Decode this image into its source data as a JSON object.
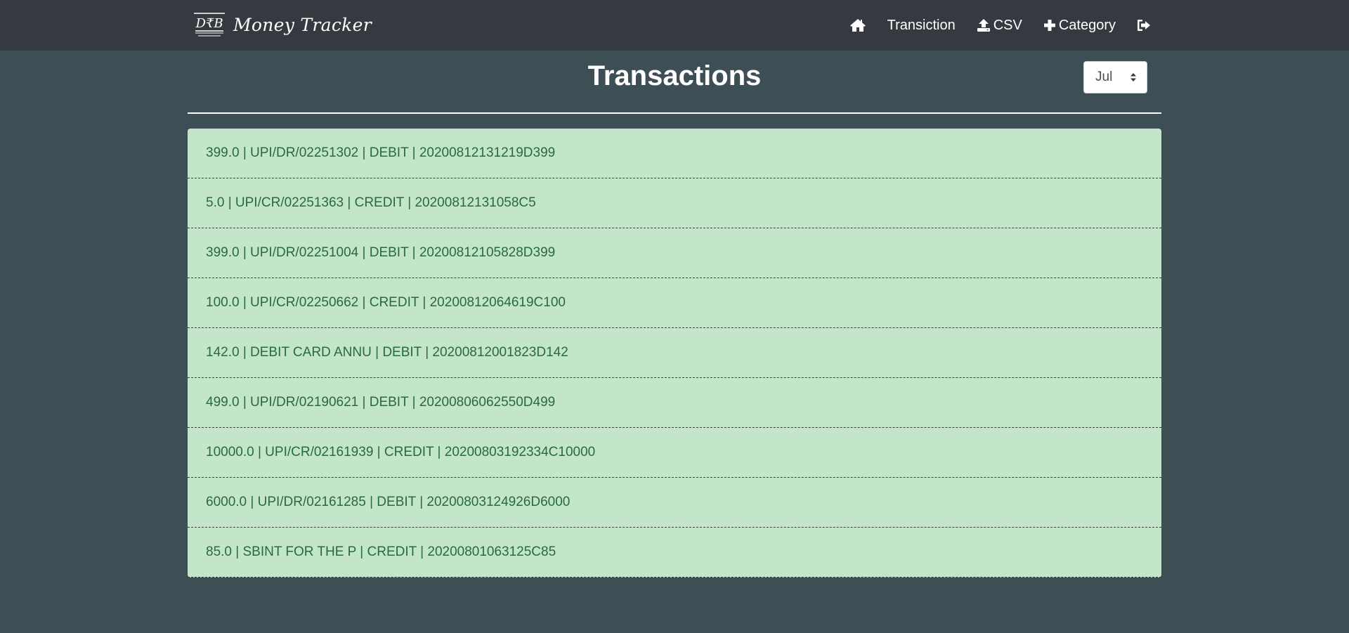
{
  "brand": {
    "name": "Money Tracker",
    "logo_text": "D₹B"
  },
  "nav": {
    "items": [
      {
        "icon": "home-icon",
        "label": ""
      },
      {
        "icon": "",
        "label": "Transiction"
      },
      {
        "icon": "upload-icon",
        "label": "CSV"
      },
      {
        "icon": "plus-icon",
        "label": "Category"
      },
      {
        "icon": "sign-out-icon",
        "label": ""
      }
    ]
  },
  "page": {
    "title": "Transactions"
  },
  "month_select": {
    "value": "Jul"
  },
  "transactions": [
    "399.0 | UPI/DR/02251302 | DEBIT | 20200812131219D399",
    "5.0 | UPI/CR/02251363 | CREDIT | 20200812131058C5",
    "399.0 | UPI/DR/02251004 | DEBIT | 20200812105828D399",
    "100.0 | UPI/CR/02250662 | CREDIT | 20200812064619C100",
    "142.0 | DEBIT CARD ANNU | DEBIT | 20200812001823D142",
    "499.0 | UPI/DR/02190621 | DEBIT | 20200806062550D499",
    "10000.0 | UPI/CR/02161939 | CREDIT | 20200803192334C10000",
    "6000.0 | UPI/DR/02161285 | DEBIT | 20200803124926D6000",
    "85.0 | SBINT FOR THE P | CREDIT | 20200801063125C85"
  ],
  "colors": {
    "navbar": "#343a40",
    "background": "#3d4e54",
    "list_background": "#c3e6cb",
    "list_text": "#2a6a3a"
  }
}
